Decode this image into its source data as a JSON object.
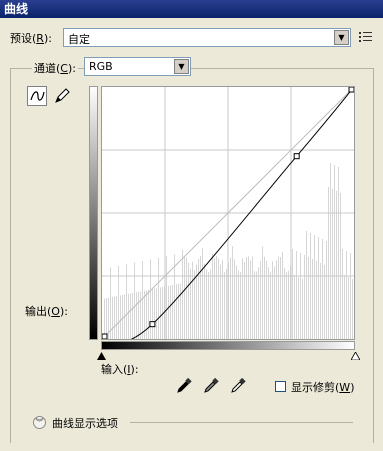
{
  "window": {
    "title": "曲线"
  },
  "preset": {
    "label_pre": "预设(",
    "label_key": "R",
    "label_post": "):",
    "value": "自定"
  },
  "channel": {
    "label_pre": "通道(",
    "label_key": "C",
    "label_post": "):",
    "value": "RGB"
  },
  "output": {
    "label_pre": "输出(",
    "label_key": "O",
    "label_post": "):"
  },
  "input": {
    "label_pre": "输入(",
    "label_key": "I",
    "label_post": "):"
  },
  "show_clipping": {
    "label_pre": "显示修剪(",
    "label_key": "W",
    "label_post": ")",
    "checked": false
  },
  "curve_options": {
    "label": "曲线显示选项"
  },
  "curve": {
    "points": [
      [
        0,
        0
      ],
      [
        51,
        15
      ],
      [
        197,
        185
      ],
      [
        255,
        255
      ]
    ],
    "channel": "RGB"
  },
  "icons": {
    "preset_menu": "list-menu-icon",
    "curve_tool": "curve-point-icon",
    "pencil_tool": "pencil-icon",
    "black_eyedropper": "eyedropper-black-icon",
    "gray_eyedropper": "eyedropper-gray-icon",
    "white_eyedropper": "eyedropper-white-icon"
  }
}
